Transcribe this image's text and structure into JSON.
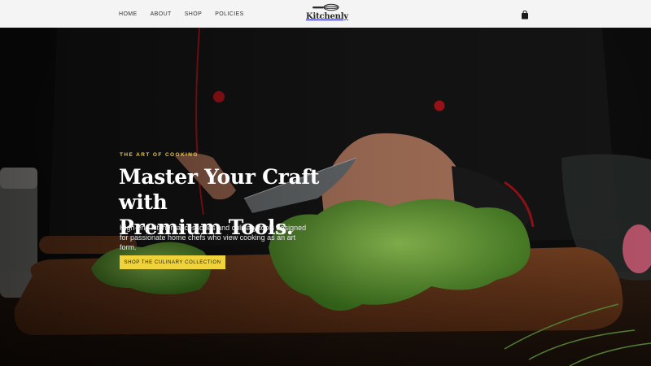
{
  "header": {
    "nav": [
      "HOME",
      "ABOUT",
      "SHOP",
      "POLICIES"
    ],
    "logo_text": "Kitchenly",
    "logo_icon": "whisk-icon",
    "cart_icon": "shopping-bag-icon"
  },
  "hero": {
    "eyebrow": "THE ART OF COOKING",
    "headline_line1": "Master Your Craft with",
    "headline_line2": "Premium Tools.",
    "subtext": "High-end kitchen accessories and culinary tools designed for passionate home chefs who view cooking as an art form.",
    "cta_label": "SHOP THE CULINARY COLLECTION"
  },
  "colors": {
    "accent": "#f0d33a",
    "eyebrow": "#e8c547",
    "header_bg": "#f4f4f4"
  }
}
